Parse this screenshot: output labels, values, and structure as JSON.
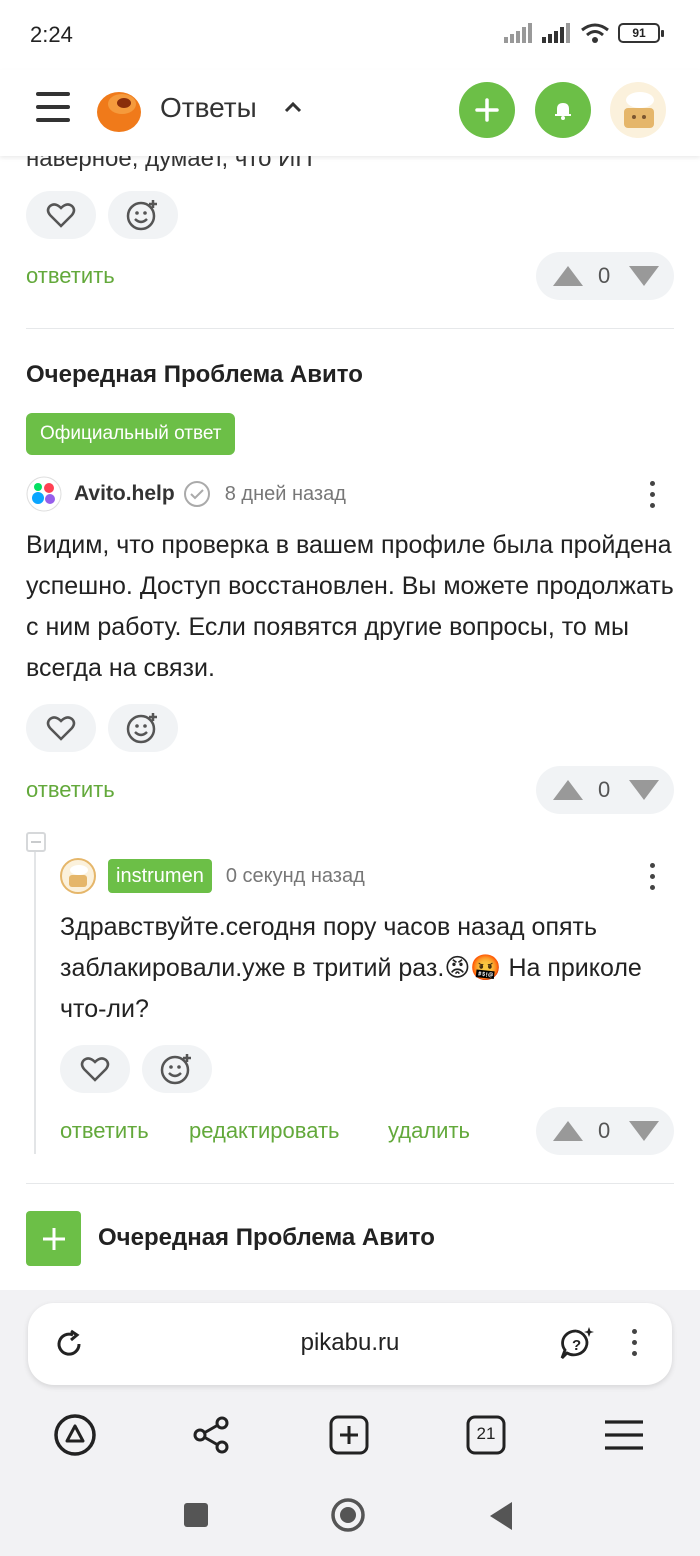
{
  "status": {
    "time": "2:24",
    "battery": "91"
  },
  "header": {
    "section_title": "Ответы"
  },
  "cut_text": "наверное, думает, что ИП",
  "vote_count_1": "0",
  "reply_label": "ответить",
  "post": {
    "title": "Очередная Проблема Авито",
    "official_badge": "Официальный ответ",
    "author": "Avito.help",
    "time": "8 дней назад",
    "text": "Видим, что проверка в вашем профиле была пройдена успешно. Доступ восстановлен. Вы можете продолжать с ним работу. Если появятся другие вопросы, то мы всегда на связи.",
    "votes": "0"
  },
  "reply": {
    "author": "instrumen",
    "time": "0 секунд назад",
    "text": "Здравствуйте.сегодня пору часов назад опять заблакировали.уже в тритий раз.😡🤬 На приколе что-ли?",
    "reply_label": "ответить",
    "edit_label": "редактировать",
    "delete_label": "удалить",
    "votes": "0"
  },
  "next_post_title": "Очередная Проблема Авито",
  "browser": {
    "url": "pikabu.ru",
    "tabs_count": "21"
  },
  "colors": {
    "accent": "#6cbf47",
    "link": "#63a93b"
  }
}
